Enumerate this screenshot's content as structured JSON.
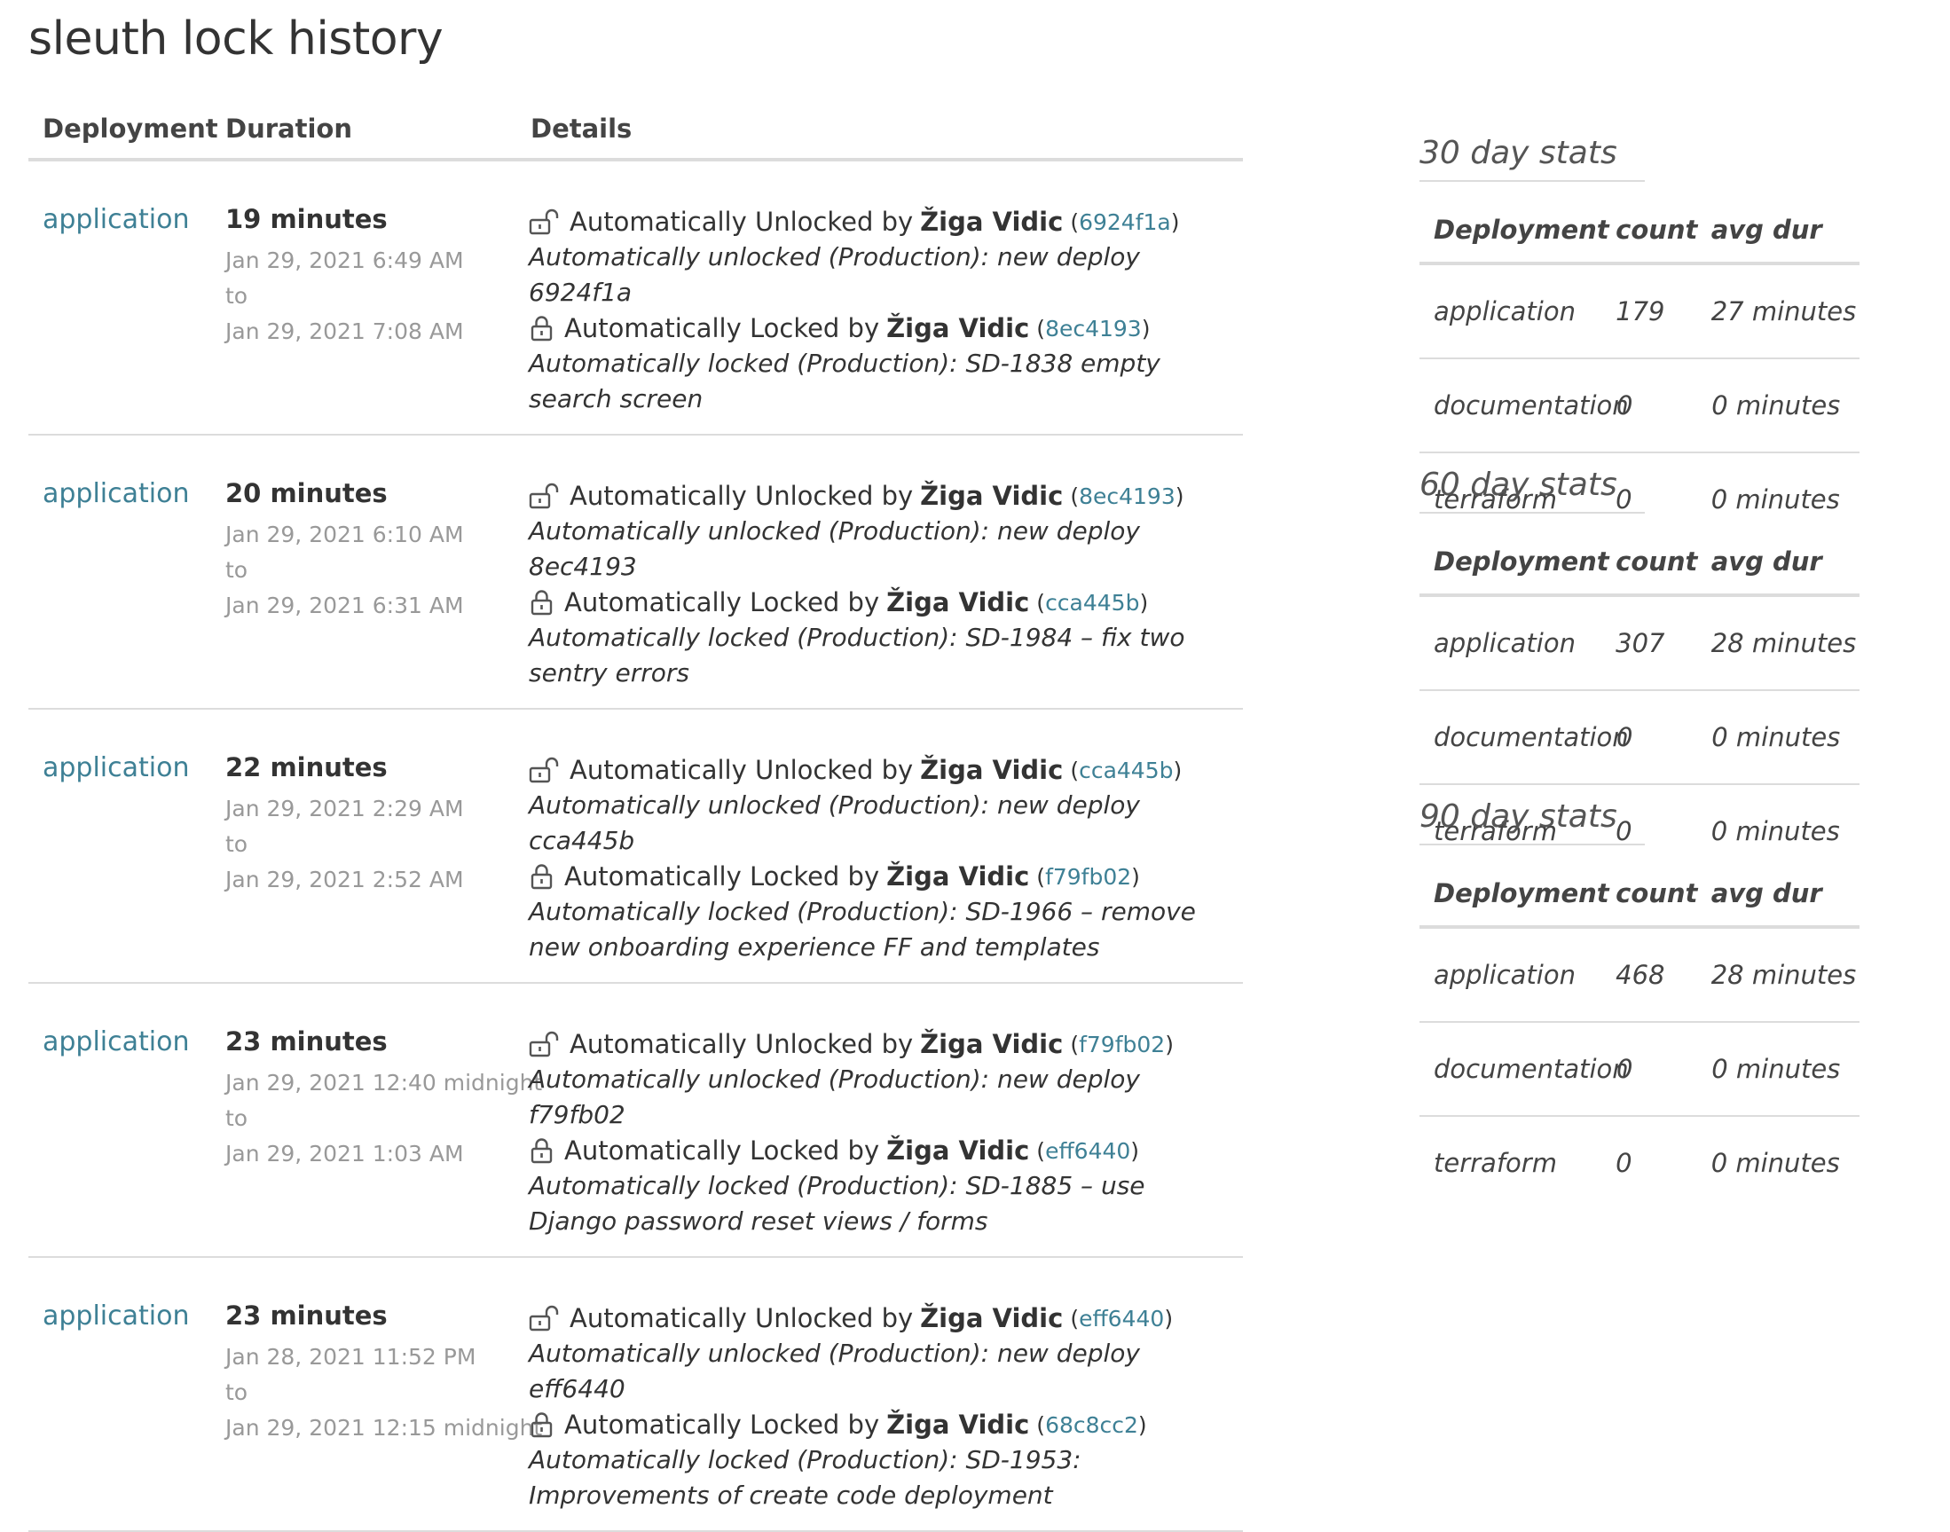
{
  "title": "sleuth lock history",
  "history": {
    "headers": {
      "deployment": "Deployment",
      "duration": "Duration",
      "details": "Details"
    },
    "rows": [
      {
        "deployment": "application",
        "duration": "19 minutes",
        "from": "Jan 29, 2021 6:49 AM",
        "to_label": "to",
        "to": "Jan 29, 2021 7:08 AM",
        "unlock": {
          "prefix": "Automatically Unlocked by",
          "actor": "Žiga Vidic",
          "open": "(",
          "hash": "6924f1a",
          "close": ")",
          "message": "Automatically unlocked (Production): new deploy 6924f1a"
        },
        "lock": {
          "prefix": "Automatically Locked by",
          "actor": "Žiga Vidic",
          "open": "(",
          "hash": "8ec4193",
          "close": ")",
          "message": "Automatically locked (Production): SD-1838 empty search screen"
        }
      },
      {
        "deployment": "application",
        "duration": "20 minutes",
        "from": "Jan 29, 2021 6:10 AM",
        "to_label": "to",
        "to": "Jan 29, 2021 6:31 AM",
        "unlock": {
          "prefix": "Automatically Unlocked by",
          "actor": "Žiga Vidic",
          "open": "(",
          "hash": "8ec4193",
          "close": ")",
          "message": "Automatically unlocked (Production): new deploy 8ec4193"
        },
        "lock": {
          "prefix": "Automatically Locked by",
          "actor": "Žiga Vidic",
          "open": "(",
          "hash": "cca445b",
          "close": ")",
          "message": "Automatically locked (Production): SD-1984 – fix two sentry errors"
        }
      },
      {
        "deployment": "application",
        "duration": "22 minutes",
        "from": "Jan 29, 2021 2:29 AM",
        "to_label": "to",
        "to": "Jan 29, 2021 2:52 AM",
        "unlock": {
          "prefix": "Automatically Unlocked by",
          "actor": "Žiga Vidic",
          "open": "(",
          "hash": "cca445b",
          "close": ")",
          "message": "Automatically unlocked (Production): new deploy cca445b"
        },
        "lock": {
          "prefix": "Automatically Locked by",
          "actor": "Žiga Vidic",
          "open": "(",
          "hash": "f79fb02",
          "close": ")",
          "message": "Automatically locked (Production): SD-1966 – remove new onboarding experience FF and templates"
        }
      },
      {
        "deployment": "application",
        "duration": "23 minutes",
        "from": "Jan 29, 2021 12:40 midnight",
        "to_label": "to",
        "to": "Jan 29, 2021 1:03 AM",
        "unlock": {
          "prefix": "Automatically Unlocked by",
          "actor": "Žiga Vidic",
          "open": "(",
          "hash": "f79fb02",
          "close": ")",
          "message": "Automatically unlocked (Production): new deploy f79fb02"
        },
        "lock": {
          "prefix": "Automatically Locked by",
          "actor": "Žiga Vidic",
          "open": "(",
          "hash": "eff6440",
          "close": ")",
          "message": "Automatically locked (Production): SD-1885 – use Django password reset views / forms"
        }
      },
      {
        "deployment": "application",
        "duration": "23 minutes",
        "from": "Jan 28, 2021 11:52 PM",
        "to_label": "to",
        "to": "Jan 29, 2021 12:15 midnight",
        "unlock": {
          "prefix": "Automatically Unlocked by",
          "actor": "Žiga Vidic",
          "open": "(",
          "hash": "eff6440",
          "close": ")",
          "message": "Automatically unlocked (Production): new deploy eff6440"
        },
        "lock": {
          "prefix": "Automatically Locked by",
          "actor": "Žiga Vidic",
          "open": "(",
          "hash": "68c8cc2",
          "close": ")",
          "message": "Automatically locked (Production): SD-1953: Improvements of create code deployment"
        }
      }
    ]
  },
  "stats": [
    {
      "title": "30 day stats",
      "headers": {
        "deployment": "Deployment",
        "count": "count",
        "avg": "avg dur"
      },
      "rows": [
        {
          "deployment": "application",
          "count": "179",
          "avg": "27 minutes"
        },
        {
          "deployment": "documentation",
          "count": "0",
          "avg": "0 minutes"
        },
        {
          "deployment": "terraform",
          "count": "0",
          "avg": "0 minutes"
        }
      ]
    },
    {
      "title": "60 day stats",
      "headers": {
        "deployment": "Deployment",
        "count": "count",
        "avg": "avg dur"
      },
      "rows": [
        {
          "deployment": "application",
          "count": "307",
          "avg": "28 minutes"
        },
        {
          "deployment": "documentation",
          "count": "0",
          "avg": "0 minutes"
        },
        {
          "deployment": "terraform",
          "count": "0",
          "avg": "0 minutes"
        }
      ]
    },
    {
      "title": "90 day stats",
      "headers": {
        "deployment": "Deployment",
        "count": "count",
        "avg": "avg dur"
      },
      "rows": [
        {
          "deployment": "application",
          "count": "468",
          "avg": "28 minutes"
        },
        {
          "deployment": "documentation",
          "count": "0",
          "avg": "0 minutes"
        },
        {
          "deployment": "terraform",
          "count": "0",
          "avg": "0 minutes"
        }
      ]
    }
  ],
  "icons": {
    "unlock": "unlock-icon",
    "lock": "lock-icon"
  },
  "colors": {
    "link": "#3e8095",
    "muted": "#999999",
    "border": "#dcdcdc"
  }
}
